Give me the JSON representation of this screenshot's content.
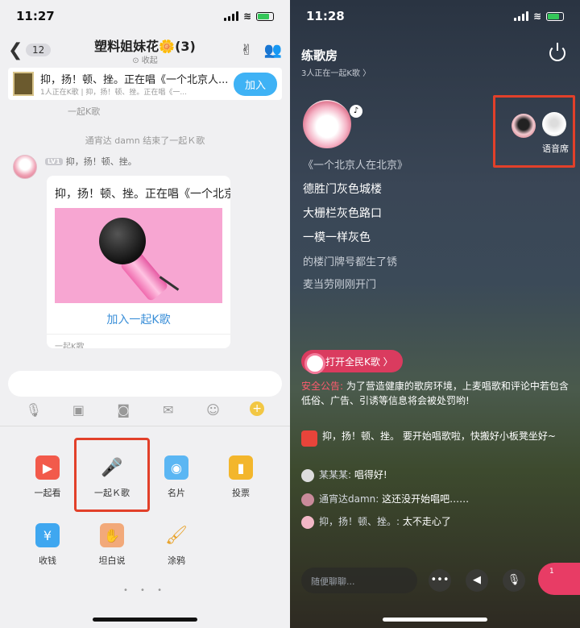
{
  "left": {
    "status_time": "11:27",
    "back_count": "12",
    "group_title": "塑料姐妹花🌼(3)",
    "group_collapse": "⊙ 收起",
    "banner_title": "抑，扬！顿、挫。正在唱《一个北京人...",
    "banner_sub": "1人正在K歌 | 抑，扬！顿、挫。正在唱《一...",
    "banner_join": "加入",
    "label_k_song": "一起K歌",
    "sys_msg": "通宵达 damn 结束了一起Ｋ歌",
    "lv_badge": "LV1",
    "msg_nick": "抑，扬！顿、挫。",
    "card_title": "抑，扬！顿、挫。正在唱《一个北京人在北京》",
    "card_join": "加入一起K歌",
    "card_footer": "一起K歌",
    "features": [
      {
        "label": "一起看",
        "color": "#f25a4b"
      },
      {
        "label": "一起Ｋ歌",
        "color": "#ec6fa8"
      },
      {
        "label": "名片",
        "color": "#5bb6f3"
      },
      {
        "label": "投票",
        "color": "#f3b62c"
      },
      {
        "label": "收钱",
        "color": "#3fa7f0"
      },
      {
        "label": "坦白说",
        "color": "#f2a97a"
      },
      {
        "label": "涂鸦",
        "color": "#f3b62c"
      }
    ],
    "page_dots": "• • •"
  },
  "right": {
    "status_time": "11:28",
    "room_title": "练歌房",
    "room_sub": "3人正在一起K歌 〉",
    "lyrics": [
      "《一个北京人在北京》",
      "德胜门灰色城楼",
      "大栅栏灰色路口",
      "一模一样灰色",
      "的楼门牌号都生了锈",
      "麦当劳刚刚开门"
    ],
    "seat_label": "语音席",
    "open_app": "打开全民K歌 〉",
    "notice_tag": "安全公告:",
    "notice_text": "为了营造健康的歌房环境，上麦唱歌和评论中若包含低俗、广告、引诱等信息将会被处罚哟!",
    "bot_msg": "抑，扬！顿、挫。 要开始唱歌啦，快搬好小板凳坐好~",
    "comments": [
      {
        "who": "某某某:",
        "text": " 唱得好!"
      },
      {
        "who": "通宵达damn:",
        "text": " 这还没开始唱吧……"
      },
      {
        "who": "抑，扬！顿、挫。:",
        "text": " 太不走心了"
      }
    ],
    "input_placeholder": "随便聊聊...",
    "gift_count": "1"
  }
}
